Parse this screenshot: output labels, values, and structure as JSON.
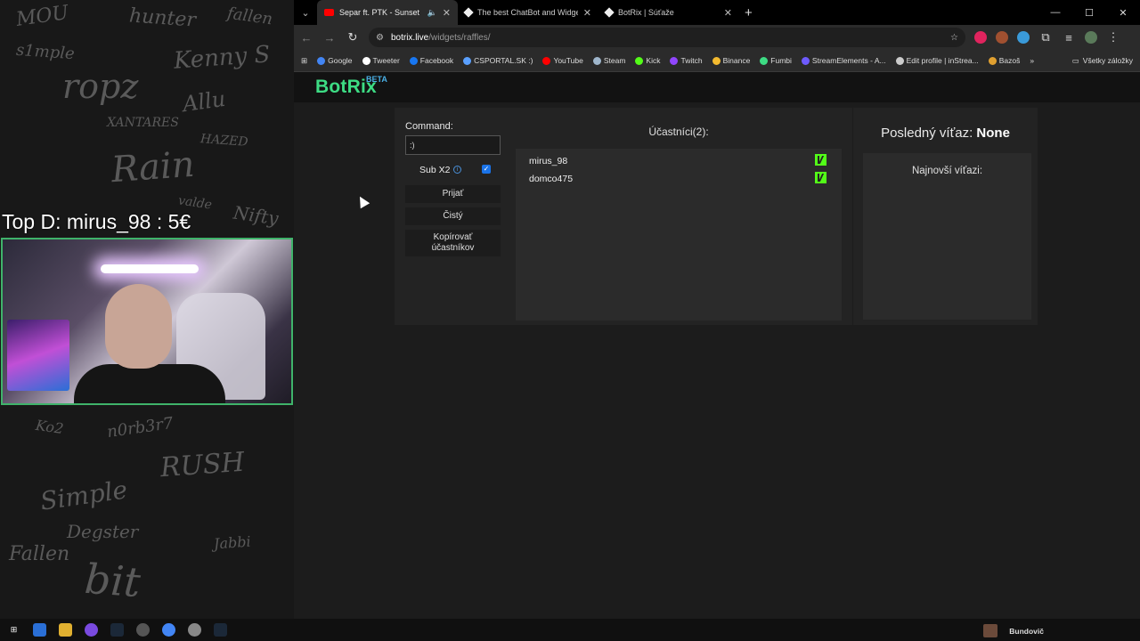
{
  "overlay": {
    "title": "Top D: mirus_98 : 5€",
    "graffiti": [
      "MOU",
      "Kenny S",
      "ropz",
      "hunter",
      "fallen",
      "Allu",
      "Rain",
      "XANTARES",
      "HAZED",
      "Nifty",
      "Simple",
      "RUSH",
      "Degster",
      "bit",
      "Ko2",
      "n0rb3r7",
      "Jabbi",
      "Fallen",
      "s1mple",
      "valde"
    ]
  },
  "browser": {
    "tabs": [
      {
        "label": "Separ ft. PTK - Sunset (prod",
        "favicon": "youtube-icon",
        "active": true
      },
      {
        "label": "The best ChatBot and Widgets",
        "favicon": "botrix-icon",
        "active": false
      },
      {
        "label": "BotRix | Súťaže",
        "favicon": "botrix-icon",
        "active": false
      }
    ],
    "url_host": "botrix.live",
    "url_path": "/widgets/raffles/",
    "bookmarks": [
      "Google",
      "Tweeter",
      "Facebook",
      "CSPORTAL.SK :)",
      "YouTube",
      "Steam",
      "Kick",
      "Twitch",
      "Binance",
      "Fumbi",
      "StreamElements - A...",
      "Edit profile | inStrea...",
      "Bazoš"
    ],
    "bookmark_colors": [
      "#4285f4",
      "#ffffff",
      "#1877f2",
      "#5aa0ff",
      "#ff0000",
      "#9fb6cc",
      "#53fc18",
      "#9146ff",
      "#f3ba2f",
      "#3ddc84",
      "#6e5bff",
      "#cccccc",
      "#e0a030"
    ],
    "all_bookmarks": "Všetky záložky"
  },
  "botrix": {
    "logo": "BotRix",
    "beta": "BETA",
    "command_label": "Command:",
    "command_value": ":)",
    "sub_label": "Sub X2",
    "sub_checked": true,
    "accept_button": "Prijať",
    "clear_button": "Čistý",
    "copy_button": "Kopírovať účastníkov",
    "participants_title": "Účastníci(2):",
    "participants": [
      "mirus_98",
      "domco475"
    ],
    "last_winner_label": "Posledný víťaz:",
    "last_winner_value": "None",
    "recent_winners_title": "Najnovší víťazi:"
  },
  "taskbar": {
    "user": "Bundovič"
  },
  "colors": {
    "brand": "#3ddc84",
    "kick": "#53fc18",
    "webcam_border": "#3fb36a"
  }
}
